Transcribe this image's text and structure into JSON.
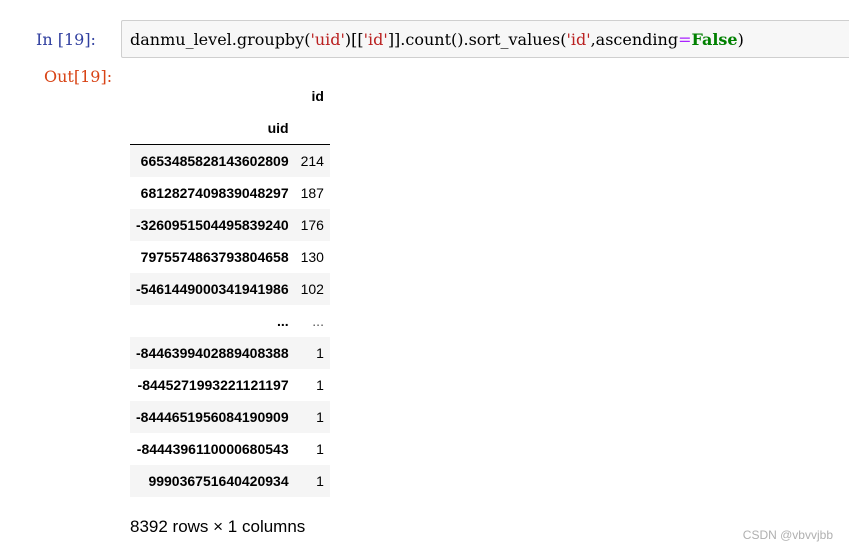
{
  "cell": {
    "input_prompt": "In  [19]:",
    "output_prompt": "Out[19]:",
    "code_tokens": {
      "t1": "danmu_level.groupby(",
      "t2": "'uid'",
      "t3": ")[[",
      "t4": "'id'",
      "t5": "]].count().sort_values(",
      "t6": "'id'",
      "t7": ",ascending",
      "t8": "=",
      "t9": "False",
      "t10": ")"
    }
  },
  "dataframe": {
    "column_header": "id",
    "index_name": "uid",
    "rows": [
      {
        "index": "6653485828143602809",
        "value": "214"
      },
      {
        "index": "6812827409839048297",
        "value": "187"
      },
      {
        "index": "-3260951504495839240",
        "value": "176"
      },
      {
        "index": "7975574863793804658",
        "value": "130"
      },
      {
        "index": "-5461449000341941986",
        "value": "102"
      },
      {
        "index": "...",
        "value": "..."
      },
      {
        "index": "-8446399402889408388",
        "value": "1"
      },
      {
        "index": "-8445271993221121197",
        "value": "1"
      },
      {
        "index": "-8444651956084190909",
        "value": "1"
      },
      {
        "index": "-8444396110000680543",
        "value": "1"
      },
      {
        "index": "999036751640420934",
        "value": "1"
      }
    ],
    "shape_text": "8392 rows × 1 columns"
  },
  "watermark": "CSDN @vbvvjbb",
  "colors": {
    "input_prompt": "#303f9f",
    "output_prompt": "#d84315",
    "string": "#ba2121",
    "keyword": "#008000",
    "operator": "#aa22ff"
  }
}
